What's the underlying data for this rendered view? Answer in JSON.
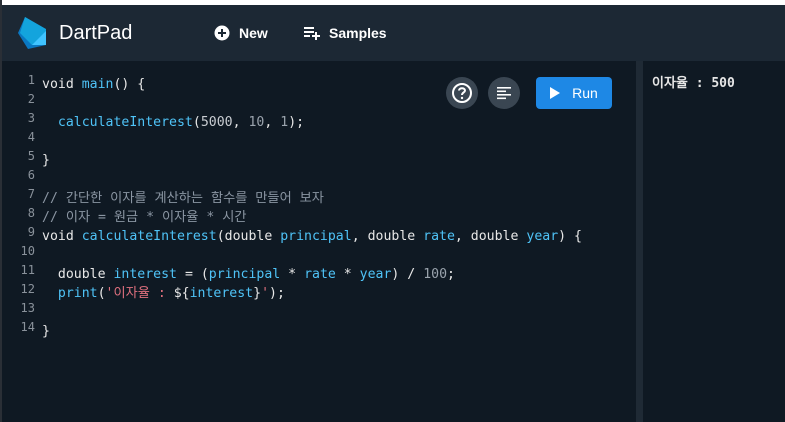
{
  "header": {
    "title": "DartPad",
    "new_label": "New",
    "samples_label": "Samples"
  },
  "editor": {
    "run_label": "Run",
    "lines": [
      {
        "n": "1",
        "tokens": [
          {
            "t": "void ",
            "c": ""
          },
          {
            "t": "main",
            "c": "tok-fn"
          },
          {
            "t": "() {",
            "c": ""
          }
        ]
      },
      {
        "n": "2",
        "tokens": []
      },
      {
        "n": "3",
        "tokens": [
          {
            "t": "  ",
            "c": ""
          },
          {
            "t": "calculateInterest",
            "c": "tok-fn"
          },
          {
            "t": "(",
            "c": ""
          },
          {
            "t": "5000",
            "c": "tok-num"
          },
          {
            "t": ", ",
            "c": ""
          },
          {
            "t": "10",
            "c": "tok-num2"
          },
          {
            "t": ", ",
            "c": ""
          },
          {
            "t": "1",
            "c": "tok-num2"
          },
          {
            "t": ");",
            "c": ""
          }
        ]
      },
      {
        "n": "4",
        "tokens": []
      },
      {
        "n": "5",
        "tokens": [
          {
            "t": "}",
            "c": ""
          }
        ]
      },
      {
        "n": "6",
        "tokens": []
      },
      {
        "n": "7",
        "tokens": [
          {
            "t": "// 간단한 이자를 계산하는 함수를 만들어 보자",
            "c": "tok-cmt"
          }
        ]
      },
      {
        "n": "8",
        "tokens": [
          {
            "t": "// 이자 = 원금 * 이자율 * 시간",
            "c": "tok-cmt"
          }
        ]
      },
      {
        "n": "9",
        "tokens": [
          {
            "t": "void ",
            "c": ""
          },
          {
            "t": "calculateInterest",
            "c": "tok-fn"
          },
          {
            "t": "(double ",
            "c": ""
          },
          {
            "t": "principal",
            "c": "tok-fn"
          },
          {
            "t": ", double ",
            "c": ""
          },
          {
            "t": "rate",
            "c": "tok-fn"
          },
          {
            "t": ", double ",
            "c": ""
          },
          {
            "t": "year",
            "c": "tok-fn"
          },
          {
            "t": ") {",
            "c": ""
          }
        ]
      },
      {
        "n": "10",
        "tokens": []
      },
      {
        "n": "11",
        "tokens": [
          {
            "t": "  double ",
            "c": ""
          },
          {
            "t": "interest",
            "c": "tok-fn"
          },
          {
            "t": " = (",
            "c": ""
          },
          {
            "t": "principal",
            "c": "tok-fn"
          },
          {
            "t": " * ",
            "c": ""
          },
          {
            "t": "rate",
            "c": "tok-fn"
          },
          {
            "t": " * ",
            "c": ""
          },
          {
            "t": "year",
            "c": "tok-fn"
          },
          {
            "t": ") / ",
            "c": ""
          },
          {
            "t": "100",
            "c": "tok-num2"
          },
          {
            "t": ";",
            "c": ""
          }
        ]
      },
      {
        "n": "12",
        "tokens": [
          {
            "t": "  ",
            "c": ""
          },
          {
            "t": "print",
            "c": "tok-fn"
          },
          {
            "t": "(",
            "c": ""
          },
          {
            "t": "'이자율 : ",
            "c": "tok-str"
          },
          {
            "t": "${",
            "c": ""
          },
          {
            "t": "interest",
            "c": "tok-fn"
          },
          {
            "t": "}",
            "c": ""
          },
          {
            "t": "'",
            "c": "tok-str"
          },
          {
            "t": ");",
            "c": ""
          }
        ]
      },
      {
        "n": "13",
        "tokens": []
      },
      {
        "n": "14",
        "tokens": [
          {
            "t": "}",
            "c": ""
          }
        ]
      }
    ]
  },
  "output": {
    "text": "이자율 : 500"
  },
  "colors": {
    "header_bg": "#1c2834",
    "editor_bg": "#0f1923",
    "run_button": "#1e88e5",
    "function_token": "#4fc3f7",
    "string_token": "#e0707e"
  },
  "icons": [
    "dart-logo",
    "add-circle-icon",
    "playlist-add-icon",
    "help-icon",
    "format-icon",
    "play-icon"
  ]
}
